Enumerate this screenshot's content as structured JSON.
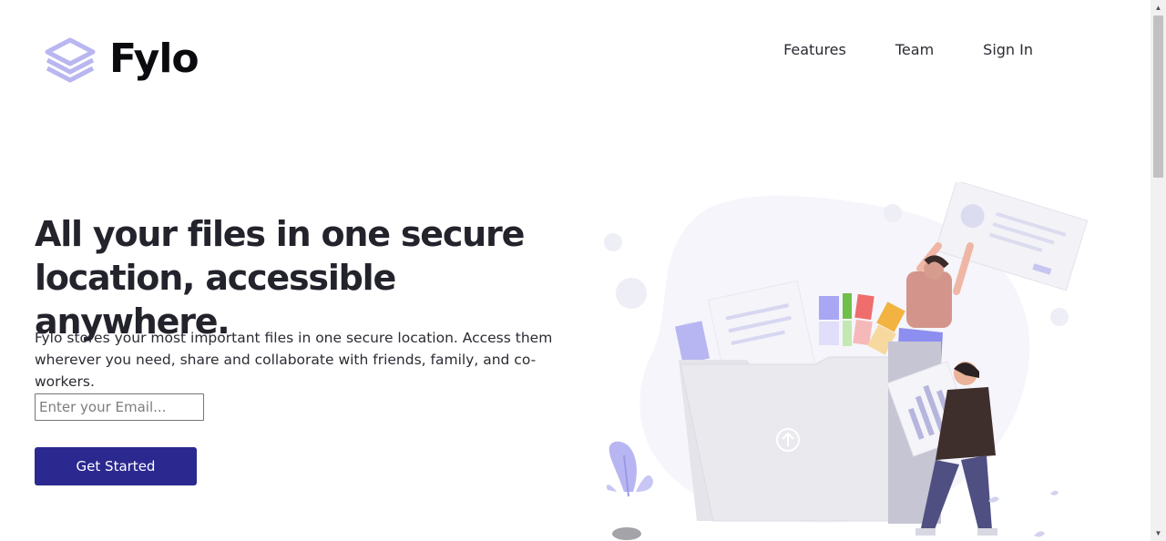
{
  "brand": {
    "name": "Fylo",
    "logo_icon": "layered-stack-icon",
    "accent_color": "#b9b6f0"
  },
  "nav": {
    "items": [
      {
        "label": "Features"
      },
      {
        "label": "Team"
      },
      {
        "label": "Sign In"
      }
    ]
  },
  "hero": {
    "title_line1": "All your files in one secure",
    "title_line2": "location, accessible anywhere.",
    "body_line1": "Fylo stores your most important files in one secure location. Access them",
    "body_line2": "wherever you need, share and collaborate with friends, family, and co-workers.",
    "email_placeholder": "Enter your Email...",
    "email_value": "",
    "cta_label": "Get Started",
    "cta_color": "#2b2990"
  },
  "illustration": {
    "name": "file-sharing-illustration",
    "upload_icon": "arrow-up-circle-icon"
  },
  "scrollbar": {
    "up_icon": "scroll-up-arrow-icon",
    "down_icon": "scroll-down-arrow-icon"
  }
}
